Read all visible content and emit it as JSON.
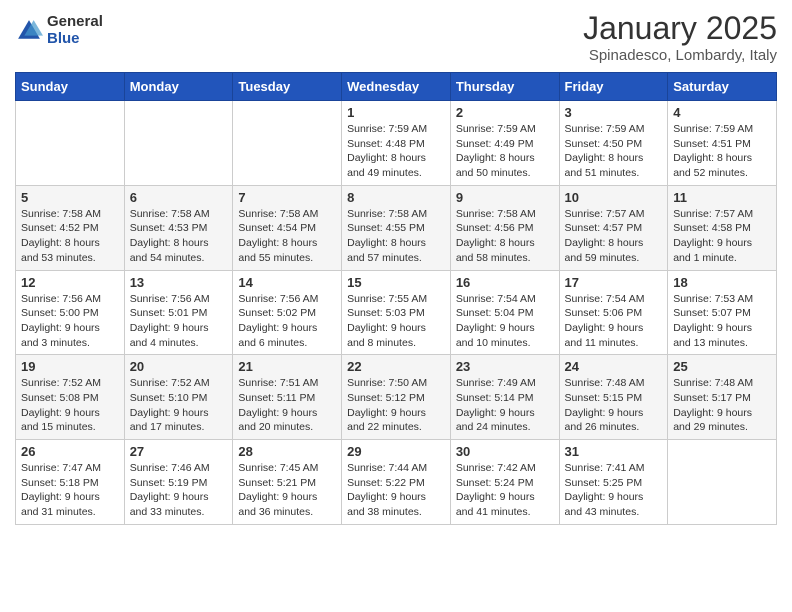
{
  "header": {
    "logo_general": "General",
    "logo_blue": "Blue",
    "month": "January 2025",
    "location": "Spinadesco, Lombardy, Italy"
  },
  "days_of_week": [
    "Sunday",
    "Monday",
    "Tuesday",
    "Wednesday",
    "Thursday",
    "Friday",
    "Saturday"
  ],
  "weeks": [
    [
      {
        "day": "",
        "info": ""
      },
      {
        "day": "",
        "info": ""
      },
      {
        "day": "",
        "info": ""
      },
      {
        "day": "1",
        "info": "Sunrise: 7:59 AM\nSunset: 4:48 PM\nDaylight: 8 hours\nand 49 minutes."
      },
      {
        "day": "2",
        "info": "Sunrise: 7:59 AM\nSunset: 4:49 PM\nDaylight: 8 hours\nand 50 minutes."
      },
      {
        "day": "3",
        "info": "Sunrise: 7:59 AM\nSunset: 4:50 PM\nDaylight: 8 hours\nand 51 minutes."
      },
      {
        "day": "4",
        "info": "Sunrise: 7:59 AM\nSunset: 4:51 PM\nDaylight: 8 hours\nand 52 minutes."
      }
    ],
    [
      {
        "day": "5",
        "info": "Sunrise: 7:58 AM\nSunset: 4:52 PM\nDaylight: 8 hours\nand 53 minutes."
      },
      {
        "day": "6",
        "info": "Sunrise: 7:58 AM\nSunset: 4:53 PM\nDaylight: 8 hours\nand 54 minutes."
      },
      {
        "day": "7",
        "info": "Sunrise: 7:58 AM\nSunset: 4:54 PM\nDaylight: 8 hours\nand 55 minutes."
      },
      {
        "day": "8",
        "info": "Sunrise: 7:58 AM\nSunset: 4:55 PM\nDaylight: 8 hours\nand 57 minutes."
      },
      {
        "day": "9",
        "info": "Sunrise: 7:58 AM\nSunset: 4:56 PM\nDaylight: 8 hours\nand 58 minutes."
      },
      {
        "day": "10",
        "info": "Sunrise: 7:57 AM\nSunset: 4:57 PM\nDaylight: 8 hours\nand 59 minutes."
      },
      {
        "day": "11",
        "info": "Sunrise: 7:57 AM\nSunset: 4:58 PM\nDaylight: 9 hours\nand 1 minute."
      }
    ],
    [
      {
        "day": "12",
        "info": "Sunrise: 7:56 AM\nSunset: 5:00 PM\nDaylight: 9 hours\nand 3 minutes."
      },
      {
        "day": "13",
        "info": "Sunrise: 7:56 AM\nSunset: 5:01 PM\nDaylight: 9 hours\nand 4 minutes."
      },
      {
        "day": "14",
        "info": "Sunrise: 7:56 AM\nSunset: 5:02 PM\nDaylight: 9 hours\nand 6 minutes."
      },
      {
        "day": "15",
        "info": "Sunrise: 7:55 AM\nSunset: 5:03 PM\nDaylight: 9 hours\nand 8 minutes."
      },
      {
        "day": "16",
        "info": "Sunrise: 7:54 AM\nSunset: 5:04 PM\nDaylight: 9 hours\nand 10 minutes."
      },
      {
        "day": "17",
        "info": "Sunrise: 7:54 AM\nSunset: 5:06 PM\nDaylight: 9 hours\nand 11 minutes."
      },
      {
        "day": "18",
        "info": "Sunrise: 7:53 AM\nSunset: 5:07 PM\nDaylight: 9 hours\nand 13 minutes."
      }
    ],
    [
      {
        "day": "19",
        "info": "Sunrise: 7:52 AM\nSunset: 5:08 PM\nDaylight: 9 hours\nand 15 minutes."
      },
      {
        "day": "20",
        "info": "Sunrise: 7:52 AM\nSunset: 5:10 PM\nDaylight: 9 hours\nand 17 minutes."
      },
      {
        "day": "21",
        "info": "Sunrise: 7:51 AM\nSunset: 5:11 PM\nDaylight: 9 hours\nand 20 minutes."
      },
      {
        "day": "22",
        "info": "Sunrise: 7:50 AM\nSunset: 5:12 PM\nDaylight: 9 hours\nand 22 minutes."
      },
      {
        "day": "23",
        "info": "Sunrise: 7:49 AM\nSunset: 5:14 PM\nDaylight: 9 hours\nand 24 minutes."
      },
      {
        "day": "24",
        "info": "Sunrise: 7:48 AM\nSunset: 5:15 PM\nDaylight: 9 hours\nand 26 minutes."
      },
      {
        "day": "25",
        "info": "Sunrise: 7:48 AM\nSunset: 5:17 PM\nDaylight: 9 hours\nand 29 minutes."
      }
    ],
    [
      {
        "day": "26",
        "info": "Sunrise: 7:47 AM\nSunset: 5:18 PM\nDaylight: 9 hours\nand 31 minutes."
      },
      {
        "day": "27",
        "info": "Sunrise: 7:46 AM\nSunset: 5:19 PM\nDaylight: 9 hours\nand 33 minutes."
      },
      {
        "day": "28",
        "info": "Sunrise: 7:45 AM\nSunset: 5:21 PM\nDaylight: 9 hours\nand 36 minutes."
      },
      {
        "day": "29",
        "info": "Sunrise: 7:44 AM\nSunset: 5:22 PM\nDaylight: 9 hours\nand 38 minutes."
      },
      {
        "day": "30",
        "info": "Sunrise: 7:42 AM\nSunset: 5:24 PM\nDaylight: 9 hours\nand 41 minutes."
      },
      {
        "day": "31",
        "info": "Sunrise: 7:41 AM\nSunset: 5:25 PM\nDaylight: 9 hours\nand 43 minutes."
      },
      {
        "day": "",
        "info": ""
      }
    ]
  ]
}
